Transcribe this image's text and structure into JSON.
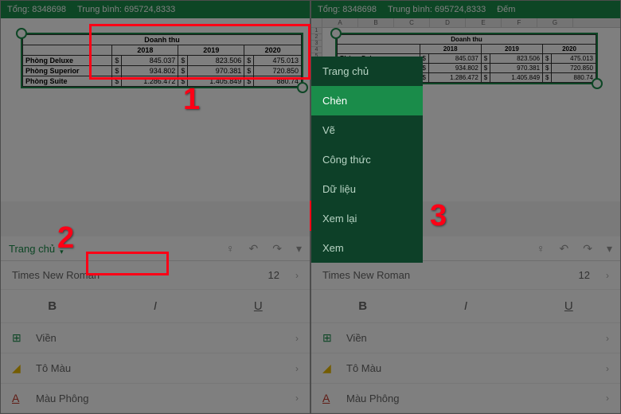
{
  "statusbar": {
    "total_label": "Tổng:",
    "total_value": "8348698",
    "avg_label": "Trung bình:",
    "avg_value": "695724,8333",
    "count_label": "Đếm"
  },
  "table": {
    "title": "Doanh thu",
    "years": [
      "2018",
      "2019",
      "2020"
    ],
    "currency": "$",
    "rows": [
      {
        "name": "Phòng Deluxe",
        "values": [
          "845.037",
          "823.506",
          "475.013"
        ]
      },
      {
        "name": "Phòng Superior",
        "values": [
          "934.802",
          "970.381",
          "720.850"
        ]
      },
      {
        "name": "Phòng Suite",
        "values": [
          "1.286.472",
          "1.405.849",
          "880.74"
        ]
      }
    ]
  },
  "toolbar": {
    "tab_label": "Trang chủ",
    "font_name": "Times New Roman",
    "font_size": "12",
    "border_label": "Viền",
    "fill_label": "Tô Màu",
    "fontcolor_label": "Màu Phông"
  },
  "menu": {
    "items": [
      "Trang chủ",
      "Chèn",
      "Vẽ",
      "Công thức",
      "Dữ liệu",
      "Xem lại",
      "Xem"
    ],
    "active": "Chèn"
  },
  "annotations": {
    "n1": "1",
    "n2": "2",
    "n3": "3"
  },
  "chart_data": {
    "type": "table",
    "title": "Doanh thu",
    "categories": [
      "2018",
      "2019",
      "2020"
    ],
    "series": [
      {
        "name": "Phòng Deluxe",
        "values": [
          845037,
          823506,
          475013
        ]
      },
      {
        "name": "Phòng Superior",
        "values": [
          934802,
          970381,
          720850
        ]
      },
      {
        "name": "Phòng Suite",
        "values": [
          1286472,
          1405849,
          880740
        ]
      }
    ]
  }
}
